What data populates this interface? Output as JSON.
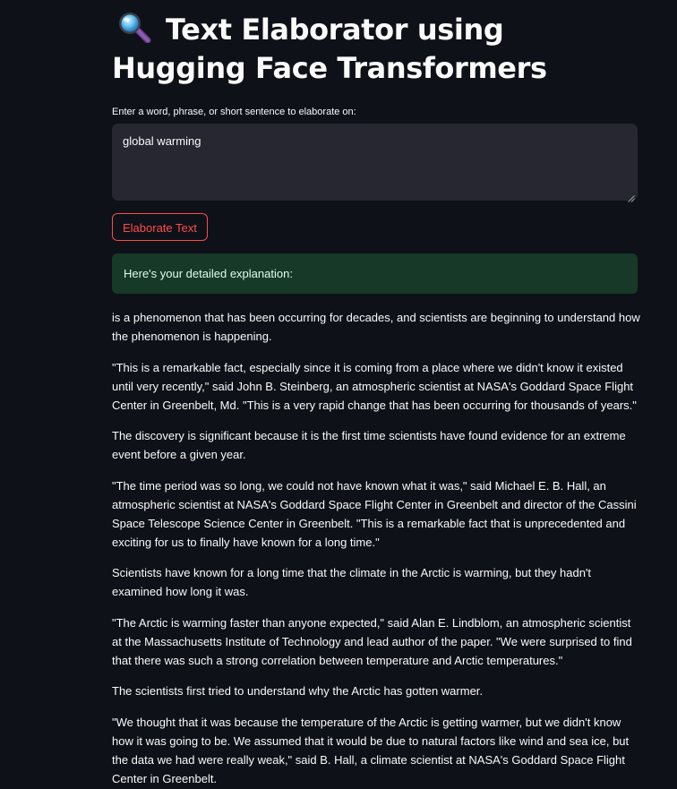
{
  "app": {
    "title_emoji": "magnifying-glass-icon",
    "title": "Text Elaborator using Hugging Face Transformers"
  },
  "input": {
    "label": "Enter a word, phrase, or short sentence to elaborate on:",
    "value": "global warming"
  },
  "button": {
    "label": "Elaborate Text"
  },
  "success": {
    "message": "Here's your detailed explanation:"
  },
  "output": {
    "paragraphs": [
      "is a phenomenon that has been occurring for decades, and scientists are beginning to understand how the phenomenon is happening.",
      "\"This is a remarkable fact, especially since it is coming from a place where we didn't know it existed until very recently,\" said John B. Steinberg, an atmospheric scientist at NASA's Goddard Space Flight Center in Greenbelt, Md. \"This is a very rapid change that has been occurring for thousands of years.\"",
      "The discovery is significant because it is the first time scientists have found evidence for an extreme event before a given year.",
      "\"The time period was so long, we could not have known what it was,\" said Michael E. B. Hall, an atmospheric scientist at NASA's Goddard Space Flight Center in Greenbelt and director of the Cassini Space Telescope Science Center in Greenbelt. \"This is a remarkable fact that is unprecedented and exciting for us to finally have known for a long time.\"",
      "Scientists have known for a long time that the climate in the Arctic is warming, but they hadn't examined how long it was.",
      "\"The Arctic is warming faster than anyone expected,\" said Alan E. Lindblom, an atmospheric scientist at the Massachusetts Institute of Technology and lead author of the paper. \"We were surprised to find that there was such a strong correlation between temperature and Arctic temperatures.\"",
      "The scientists first tried to understand why the Arctic has gotten warmer.",
      "\"We thought that it was because the temperature of the Arctic is getting warmer, but we didn't know how it was going to be. We assumed that it would be due to natural factors like wind and sea ice, but the data we had were really weak,\" said B. Hall, a climate scientist at NASA's Goddard Space Flight Center in Greenbelt."
    ]
  },
  "colors": {
    "background": "#0e1117",
    "input_background": "#262730",
    "accent": "#ff4b4b",
    "success_background": "#173928",
    "success_text": "#dffde9",
    "text": "#fafafa"
  }
}
